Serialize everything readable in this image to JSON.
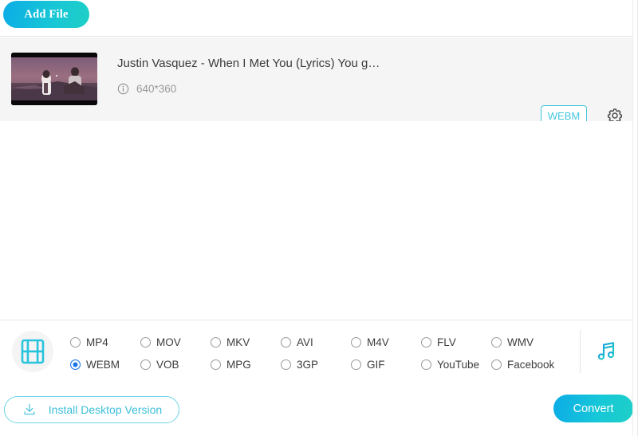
{
  "header": {
    "add_file_label": "Add File"
  },
  "file": {
    "title": "Justin Vasquez - When I Met You (Lyrics) You g…",
    "resolution": "640*360",
    "output_format_badge": "WEBM",
    "info_icon": "info-circle-icon",
    "settings_icon": "gear-icon",
    "thumbnail_alt": "video-thumbnail"
  },
  "formats": {
    "video_icon": "film-strip-icon",
    "audio_icon": "music-note-icon",
    "selected": "WEBM",
    "rows": [
      [
        "MP4",
        "MOV",
        "MKV",
        "AVI",
        "M4V",
        "FLV",
        "WMV"
      ],
      [
        "WEBM",
        "VOB",
        "MPG",
        "3GP",
        "GIF",
        "YouTube",
        "Facebook"
      ]
    ]
  },
  "footer": {
    "install_label": "Install Desktop Version",
    "install_icon": "download-icon",
    "convert_label": "Convert"
  },
  "colors": {
    "accent_start": "#0cace6",
    "accent_end": "#1ecfc7",
    "badge_border": "#45c6dd",
    "radio_selected": "#1a73e8",
    "row_background": "#f5f5f5"
  }
}
